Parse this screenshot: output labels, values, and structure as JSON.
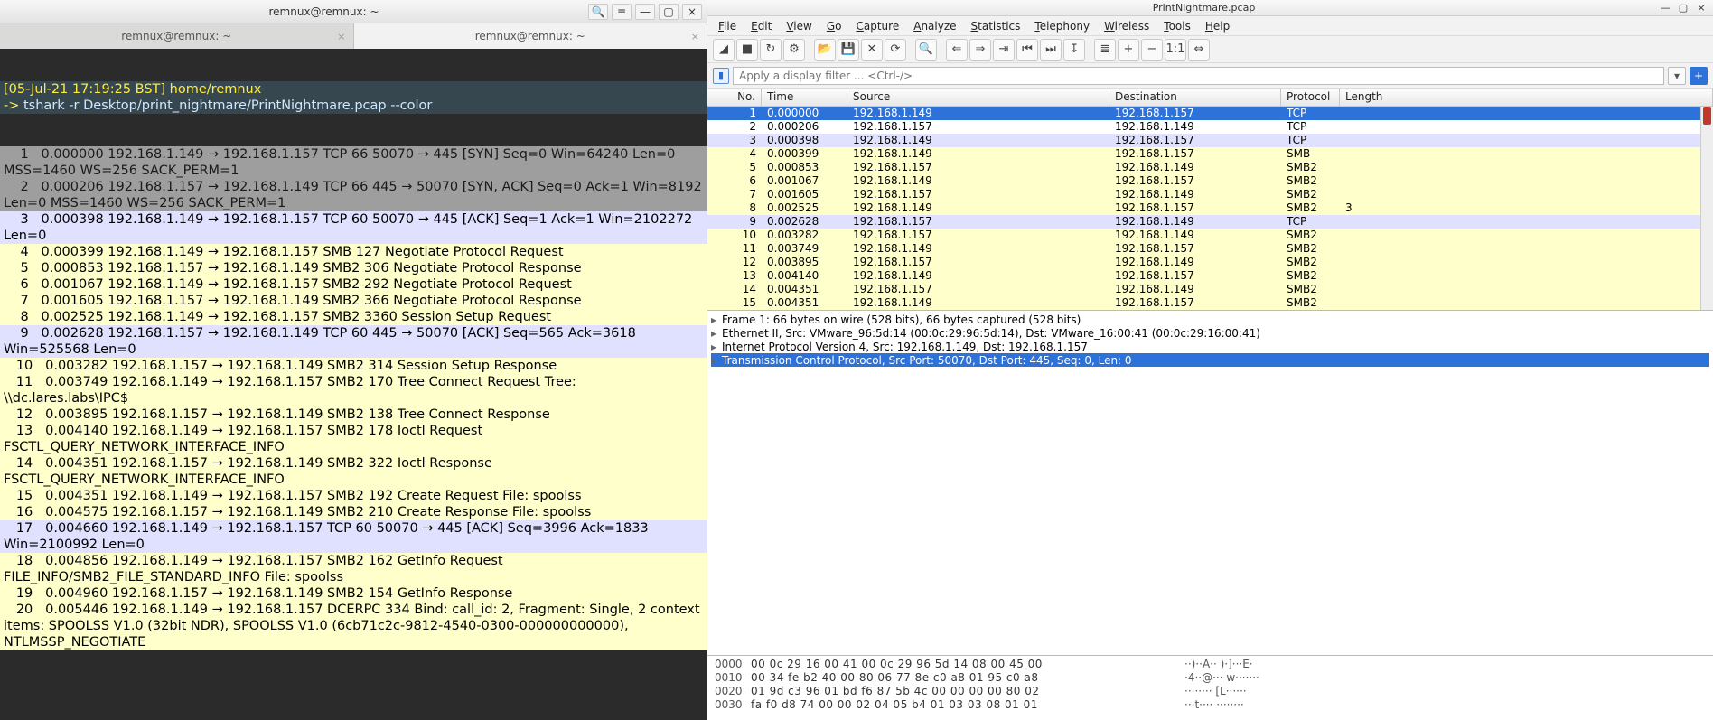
{
  "terminal": {
    "title": "remnux@remnux: ~",
    "titlebar_icons": {
      "search": "🔍",
      "menu": "≡",
      "min": "—",
      "max": "▢",
      "close": "×"
    },
    "tabs": [
      {
        "label": "remnux@remnux: ~",
        "active": false
      },
      {
        "label": "remnux@remnux: ~",
        "active": true
      }
    ],
    "prompt_time": "[05-Jul-21 17:19:25 BST]",
    "prompt_path": " home/remnux",
    "prompt_marker": "-> ",
    "command": "tshark -r Desktop/print_nightmare/PrintNightmare.pcap --color",
    "lines": [
      {
        "cls": "syn",
        "text": "    1   0.000000 192.168.1.149 → 192.168.1.157 TCP 66 50070 → 445 [SYN] Seq=0 Win=64240 Len=0 MSS=1460 WS=256 SACK_PERM=1"
      },
      {
        "cls": "syn",
        "text": "    2   0.000206 192.168.1.157 → 192.168.1.149 TCP 66 445 → 50070 [SYN, ACK] Seq=0 Ack=1 Win=8192 Len=0 MSS=1460 WS=256 SACK_PERM=1"
      },
      {
        "cls": "ack",
        "text": "    3   0.000398 192.168.1.149 → 192.168.1.157 TCP 60 50070 → 445 [ACK] Seq=1 Ack=1 Win=2102272 Len=0"
      },
      {
        "cls": "smb",
        "text": "    4   0.000399 192.168.1.149 → 192.168.1.157 SMB 127 Negotiate Protocol Request"
      },
      {
        "cls": "smb",
        "text": "    5   0.000853 192.168.1.157 → 192.168.1.149 SMB2 306 Negotiate Protocol Response"
      },
      {
        "cls": "smb",
        "text": "    6   0.001067 192.168.1.149 → 192.168.1.157 SMB2 292 Negotiate Protocol Request"
      },
      {
        "cls": "smb",
        "text": "    7   0.001605 192.168.1.157 → 192.168.1.149 SMB2 366 Negotiate Protocol Response"
      },
      {
        "cls": "smb",
        "text": "    8   0.002525 192.168.1.149 → 192.168.1.157 SMB2 3360 Session Setup Request"
      },
      {
        "cls": "ack",
        "text": "    9   0.002628 192.168.1.157 → 192.168.1.149 TCP 60 445 → 50070 [ACK] Seq=565 Ack=3618 Win=525568 Len=0"
      },
      {
        "cls": "smb",
        "text": "   10   0.003282 192.168.1.157 → 192.168.1.149 SMB2 314 Session Setup Response"
      },
      {
        "cls": "smb",
        "text": "   11   0.003749 192.168.1.149 → 192.168.1.157 SMB2 170 Tree Connect Request Tree: \\\\dc.lares.labs\\IPC$"
      },
      {
        "cls": "smb",
        "text": "   12   0.003895 192.168.1.157 → 192.168.1.149 SMB2 138 Tree Connect Response"
      },
      {
        "cls": "smb",
        "text": "   13   0.004140 192.168.1.149 → 192.168.1.157 SMB2 178 Ioctl Request FSCTL_QUERY_NETWORK_INTERFACE_INFO"
      },
      {
        "cls": "smb",
        "text": "   14   0.004351 192.168.1.157 → 192.168.1.149 SMB2 322 Ioctl Response FSCTL_QUERY_NETWORK_INTERFACE_INFO"
      },
      {
        "cls": "smb",
        "text": "   15   0.004351 192.168.1.149 → 192.168.1.157 SMB2 192 Create Request File: spoolss"
      },
      {
        "cls": "smb",
        "text": "   16   0.004575 192.168.1.157 → 192.168.1.149 SMB2 210 Create Response File: spoolss"
      },
      {
        "cls": "ack",
        "text": "   17   0.004660 192.168.1.149 → 192.168.1.157 TCP 60 50070 → 445 [ACK] Seq=3996 Ack=1833 Win=2100992 Len=0"
      },
      {
        "cls": "smb",
        "text": "   18   0.004856 192.168.1.149 → 192.168.1.157 SMB2 162 GetInfo Request FILE_INFO/SMB2_FILE_STANDARD_INFO File: spoolss"
      },
      {
        "cls": "smb",
        "text": "   19   0.004960 192.168.1.157 → 192.168.1.149 SMB2 154 GetInfo Response"
      },
      {
        "cls": "smb",
        "text": "   20   0.005446 192.168.1.149 → 192.168.1.157 DCERPC 334 Bind: call_id: 2, Fragment: Single, 2 context items: SPOOLSS V1.0 (32bit NDR), SPOOLSS V1.0 (6cb71c2c-9812-4540-0300-000000000000), NTLMSSP_NEGOTIATE"
      }
    ]
  },
  "wireshark": {
    "title": "PrintNightmare.pcap",
    "titlebar": {
      "min": "—",
      "max": "▢",
      "close": "×"
    },
    "menus": [
      "File",
      "Edit",
      "View",
      "Go",
      "Capture",
      "Analyze",
      "Statistics",
      "Telephony",
      "Wireless",
      "Tools",
      "Help"
    ],
    "toolbar_icons": [
      "shark-fin-icon",
      "stop-icon",
      "restart-icon",
      "options-icon",
      "open-icon",
      "save-icon",
      "close-file-icon",
      "reload-icon",
      "find-icon",
      "prev-icon",
      "next-icon",
      "jump-icon",
      "first-icon",
      "last-icon",
      "autoscroll-icon",
      "colorize-icon",
      "zoom-in-icon",
      "zoom-out-icon",
      "zoom-reset-icon",
      "resize-cols-icon"
    ],
    "toolbar_glyphs": [
      "◢",
      "■",
      "↻",
      "⚙",
      "📂",
      "💾",
      "✕",
      "⟳",
      "🔍",
      "⇐",
      "⇒",
      "⇥",
      "⏮",
      "⏭",
      "↧",
      "≣",
      "+",
      "−",
      "1:1",
      "⇔"
    ],
    "filter_placeholder": "Apply a display filter ... <Ctrl-/>",
    "columns": {
      "no": "No.",
      "time": "Time",
      "src": "Source",
      "dst": "Destination",
      "proto": "Protocol",
      "len": "Length"
    },
    "packets": [
      {
        "no": "1",
        "time": "0.000000",
        "src": "192.168.1.149",
        "dst": "192.168.1.157",
        "proto": "TCP",
        "len": "",
        "cls": "sel"
      },
      {
        "no": "2",
        "time": "0.000206",
        "src": "192.168.1.157",
        "dst": "192.168.1.149",
        "proto": "TCP",
        "len": "",
        "cls": "plain2"
      },
      {
        "no": "3",
        "time": "0.000398",
        "src": "192.168.1.149",
        "dst": "192.168.1.157",
        "proto": "TCP",
        "len": "",
        "cls": "ack2"
      },
      {
        "no": "4",
        "time": "0.000399",
        "src": "192.168.1.149",
        "dst": "192.168.1.157",
        "proto": "SMB",
        "len": "",
        "cls": "smb2"
      },
      {
        "no": "5",
        "time": "0.000853",
        "src": "192.168.1.157",
        "dst": "192.168.1.149",
        "proto": "SMB2",
        "len": "",
        "cls": "smb2"
      },
      {
        "no": "6",
        "time": "0.001067",
        "src": "192.168.1.149",
        "dst": "192.168.1.157",
        "proto": "SMB2",
        "len": "",
        "cls": "smb2"
      },
      {
        "no": "7",
        "time": "0.001605",
        "src": "192.168.1.157",
        "dst": "192.168.1.149",
        "proto": "SMB2",
        "len": "",
        "cls": "smb2"
      },
      {
        "no": "8",
        "time": "0.002525",
        "src": "192.168.1.149",
        "dst": "192.168.1.157",
        "proto": "SMB2",
        "len": "3",
        "cls": "smb2"
      },
      {
        "no": "9",
        "time": "0.002628",
        "src": "192.168.1.157",
        "dst": "192.168.1.149",
        "proto": "TCP",
        "len": "",
        "cls": "ack2"
      },
      {
        "no": "10",
        "time": "0.003282",
        "src": "192.168.1.157",
        "dst": "192.168.1.149",
        "proto": "SMB2",
        "len": "",
        "cls": "smb2"
      },
      {
        "no": "11",
        "time": "0.003749",
        "src": "192.168.1.149",
        "dst": "192.168.1.157",
        "proto": "SMB2",
        "len": "",
        "cls": "smb2"
      },
      {
        "no": "12",
        "time": "0.003895",
        "src": "192.168.1.157",
        "dst": "192.168.1.149",
        "proto": "SMB2",
        "len": "",
        "cls": "smb2"
      },
      {
        "no": "13",
        "time": "0.004140",
        "src": "192.168.1.149",
        "dst": "192.168.1.157",
        "proto": "SMB2",
        "len": "",
        "cls": "smb2"
      },
      {
        "no": "14",
        "time": "0.004351",
        "src": "192.168.1.157",
        "dst": "192.168.1.149",
        "proto": "SMB2",
        "len": "",
        "cls": "smb2"
      },
      {
        "no": "15",
        "time": "0.004351",
        "src": "192.168.1.149",
        "dst": "192.168.1.157",
        "proto": "SMB2",
        "len": "",
        "cls": "smb2"
      }
    ],
    "details": [
      {
        "text": "Frame 1: 66 bytes on wire (528 bits), 66 bytes captured (528 bits)",
        "sel": false
      },
      {
        "text": "Ethernet II, Src: VMware_96:5d:14 (00:0c:29:96:5d:14), Dst: VMware_16:00:41 (00:0c:29:16:00:41)",
        "sel": false
      },
      {
        "text": "Internet Protocol Version 4, Src: 192.168.1.149, Dst: 192.168.1.157",
        "sel": false
      },
      {
        "text": "Transmission Control Protocol, Src Port: 50070, Dst Port: 445, Seq: 0, Len: 0",
        "sel": true
      }
    ],
    "hex": [
      {
        "off": "0000",
        "bytes": "00 0c 29 16 00 41 00 0c  29 96 5d 14 08 00 45 00",
        "ascii": "··)··A·· )·]···E·"
      },
      {
        "off": "0010",
        "bytes": "00 34 fe b2 40 00 80 06  77 8e c0 a8 01 95 c0 a8",
        "ascii": "·4··@··· w·······"
      },
      {
        "off": "0020",
        "bytes": "01 9d c3 96 01 bd f6 87  5b 4c 00 00 00 00 80 02",
        "ascii": "········ [L······"
      },
      {
        "off": "0030",
        "bytes": "fa f0 d8 74 00 00 02 04  05 b4 01 03 03 08 01 01",
        "ascii": "···t···· ········"
      }
    ]
  }
}
